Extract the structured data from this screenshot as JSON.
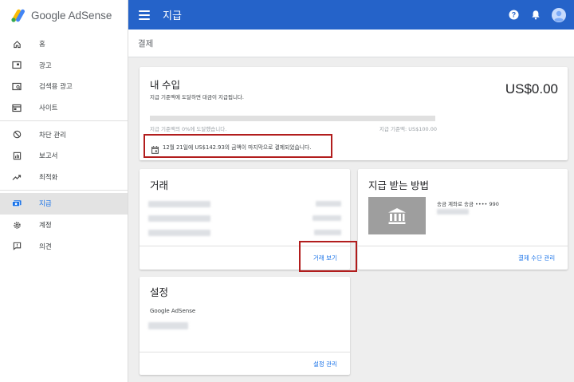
{
  "app": {
    "logo_text": "Google AdSense",
    "header_title": "지급",
    "page_title": "결제",
    "accent_color": "#2563c9"
  },
  "sidebar": {
    "items": [
      {
        "label": "홈",
        "icon": "home-icon"
      },
      {
        "label": "광고",
        "icon": "ads-icon"
      },
      {
        "label": "검색용 광고",
        "icon": "search-ads-icon"
      },
      {
        "label": "사이트",
        "icon": "sites-icon"
      },
      {
        "label": "차단 관리",
        "icon": "block-icon"
      },
      {
        "label": "보고서",
        "icon": "reports-icon"
      },
      {
        "label": "최적화",
        "icon": "trending-icon"
      },
      {
        "label": "지급",
        "icon": "payments-icon",
        "active": true
      },
      {
        "label": "계정",
        "icon": "gear-icon"
      },
      {
        "label": "의견",
        "icon": "feedback-icon"
      }
    ]
  },
  "earnings": {
    "title": "내 수입",
    "description": "지급 기준액에 도달하면 대금이 지급됩니다.",
    "balance": "US$0.00",
    "progress_fraction": 0.0,
    "progress_caption": "지급 기준액의 0%에 도달했습니다.",
    "threshold_caption": "지급 기준액: US$100.00",
    "last_payment": "12월 21일에 US$142.93의 금액이 마지막으로 결제되었습니다."
  },
  "transactions": {
    "title": "거래",
    "view_link": "거래 보기"
  },
  "payment_method": {
    "title": "지급 받는 방법",
    "account_label": "송금 계좌로 송금 •••• 990",
    "manage_link": "결제 수단 관리"
  },
  "settings": {
    "title": "설정",
    "account_name": "Google AdSense",
    "manage_link": "설정 관리"
  }
}
